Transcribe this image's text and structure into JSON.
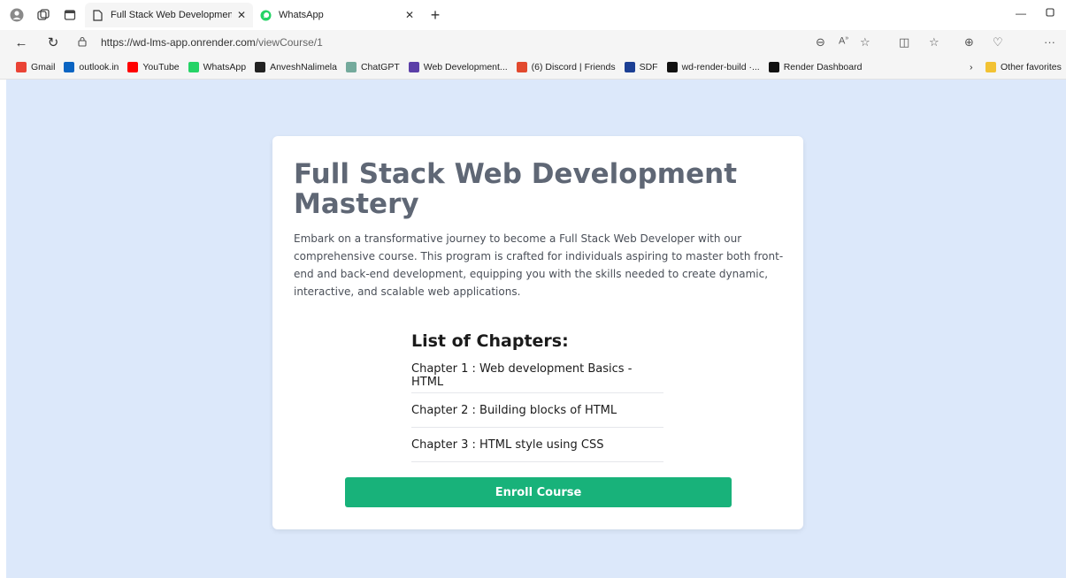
{
  "browser": {
    "tabs": [
      {
        "label": "Full Stack Web Development Ma",
        "active": true
      },
      {
        "label": "WhatsApp",
        "active": false
      }
    ],
    "url": {
      "host": "https://wd-lms-app.onrender.com",
      "path": "/viewCourse/1"
    },
    "bookmarks": [
      {
        "label": "Gmail",
        "color": "#ea4335"
      },
      {
        "label": "outlook.in",
        "color": "#0a64c2"
      },
      {
        "label": "YouTube",
        "color": "#ff0000"
      },
      {
        "label": "WhatsApp",
        "color": "#25d366"
      },
      {
        "label": "AnveshNalimela",
        "color": "#222222"
      },
      {
        "label": "ChatGPT",
        "color": "#74aa9c"
      },
      {
        "label": "Web Development...",
        "color": "#5b3fa8"
      },
      {
        "label": "(6) Discord | Friends",
        "color": "#e2492e"
      },
      {
        "label": "SDF",
        "color": "#1c3f94"
      },
      {
        "label": "wd-render-build ·...",
        "color": "#111111"
      },
      {
        "label": "Render Dashboard",
        "color": "#111111"
      }
    ],
    "other_favorites": "Other favorites"
  },
  "course": {
    "title": "Full Stack Web Development Mastery",
    "description": "Embark on a transformative journey to become a Full Stack Web Developer with our comprehensive course. This program is crafted for individuals aspiring to master both front-end and back-end development, equipping you with the skills needed to create dynamic, interactive, and scalable web applications.",
    "chapters_heading": "List of Chapters:",
    "chapters": [
      "Chapter 1 : Web development Basics - HTML",
      "Chapter 2 : Building blocks of HTML",
      "Chapter 3 : HTML style using CSS"
    ],
    "enroll_label": "Enroll Course"
  },
  "colors": {
    "page_bg": "#dce8fa",
    "accent": "#18b27a"
  }
}
